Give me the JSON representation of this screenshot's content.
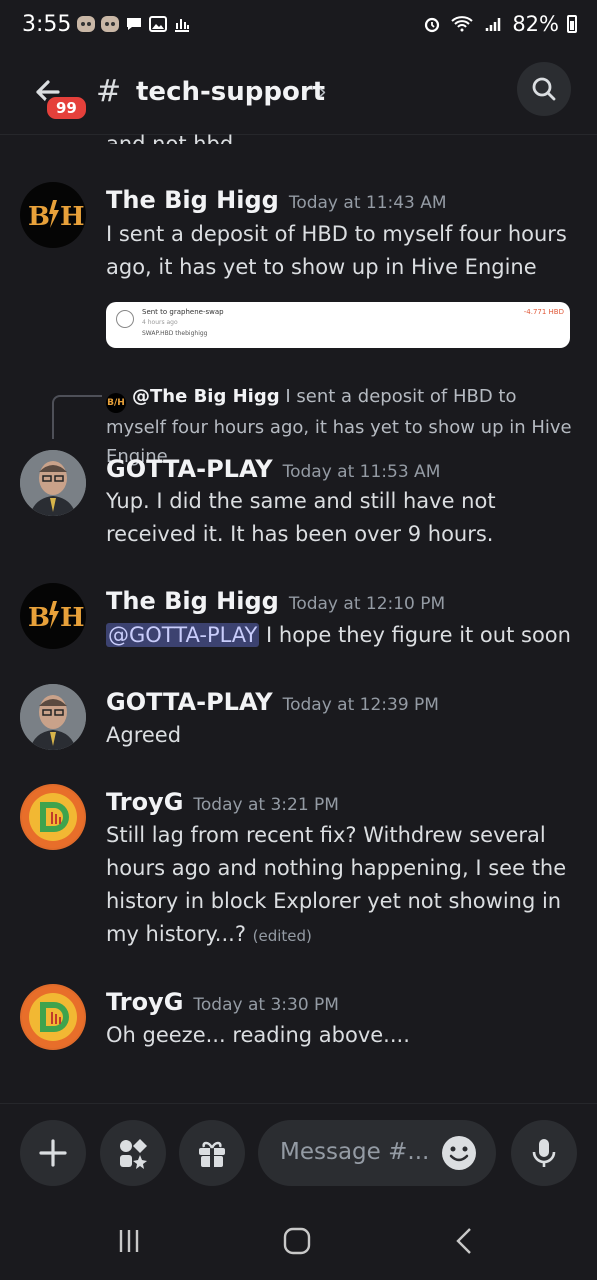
{
  "status": {
    "time": "3:55",
    "battery": "82%"
  },
  "header": {
    "hash": "#",
    "channel": "tech-support",
    "badge": "99"
  },
  "cutoff_text": "and not hbd.",
  "attachment": {
    "line1": "Sent to graphene-swap",
    "line2": "4 hours ago",
    "line3": "SWAP.HBD thebighigg",
    "amount": "-4.771 HBD"
  },
  "reply": {
    "author": "@The Big Higg",
    "text": "I sent a deposit of HBD to myself four hours ago, it has yet to show up in Hive Engine"
  },
  "messages": [
    {
      "author": "The Big Higg",
      "time": "Today at 11:43 AM",
      "text": "I sent a deposit of HBD to myself four hours ago, it has yet to show up in Hive Engine"
    },
    {
      "author": "GOTTA-PLAY",
      "time": "Today at 11:53 AM",
      "text": "Yup. I did the same and still have not received it. It has been over 9 hours."
    },
    {
      "author": "The Big Higg",
      "time": "Today at 12:10 PM",
      "mention": "@GOTTA-PLAY",
      "text": " I hope they figure it out soon"
    },
    {
      "author": "GOTTA-PLAY",
      "time": "Today at 12:39 PM",
      "text": "Agreed"
    },
    {
      "author": "TroyG",
      "time": "Today at 3:21 PM",
      "text": "Still lag from recent fix? Withdrew several hours ago and nothing happening, I see the history in block Explorer yet not showing in my history...? ",
      "edited": "(edited)"
    },
    {
      "author": "TroyG",
      "time": "Today at 3:30 PM",
      "text": "Oh geeze... reading above...."
    }
  ],
  "composer": {
    "placeholder": "Message #..."
  },
  "icons": {
    "back": "arrow-left-icon",
    "search": "search-icon",
    "plus": "plus-icon",
    "apps": "apps-icon",
    "gift": "gift-icon",
    "emoji": "emoji-icon",
    "mic": "microphone-icon"
  },
  "colors": {
    "background": "#1a1a1e",
    "badge": "#e5403b",
    "mention_bg": "#3c4270",
    "muted": "#949ba4"
  }
}
